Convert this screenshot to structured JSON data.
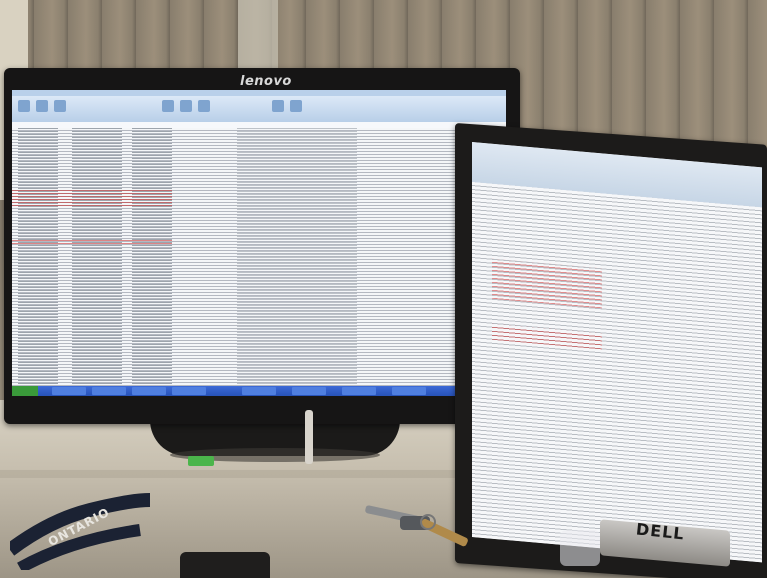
{
  "scene": {
    "description_labels": {
      "left_monitor_brand": "lenovo",
      "right_monitor_brand": "DELL",
      "lanyard_text": "ONTARIO"
    },
    "colors": {
      "wall": "#8b8171",
      "desk": "#d9d3c4",
      "bezel": "#161515",
      "spreadsheet_bg": "#f4f6f8",
      "ribbon": "#b8cfe8",
      "taskbar": "#2752b8",
      "highlight_rows": "#c82828",
      "green_tag": "#4bb54b"
    }
  }
}
